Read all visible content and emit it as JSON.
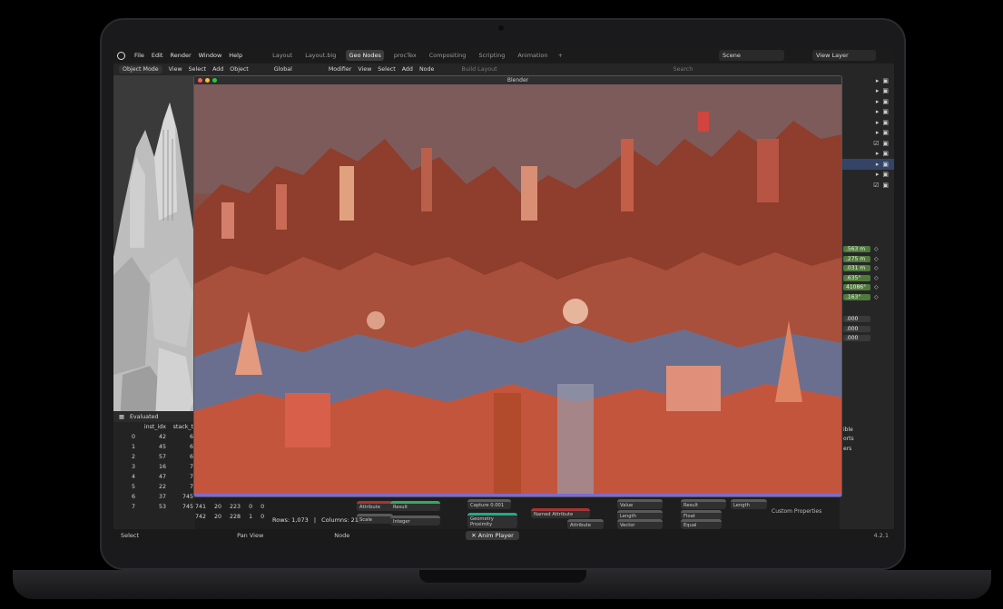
{
  "menus": [
    "File",
    "Edit",
    "Render",
    "Window",
    "Help"
  ],
  "workspace_tabs": [
    {
      "label": "Layout",
      "active": false
    },
    {
      "label": "Layout.big",
      "active": false
    },
    {
      "label": "Geo Nodes",
      "active": true
    },
    {
      "label": "procTex",
      "active": false
    },
    {
      "label": "Compositing",
      "active": false
    },
    {
      "label": "Scripting",
      "active": false
    },
    {
      "label": "Animation",
      "active": false
    }
  ],
  "plus_tab": "+",
  "scene": "Scene",
  "view_layer": "View Layer",
  "toolbar": {
    "mode": "Object Mode",
    "view": "View",
    "select": "Select",
    "add": "Add",
    "object": "Object",
    "orientation": "Global",
    "modifier": "Modifier",
    "view2": "View",
    "select2": "Select",
    "add2": "Add",
    "node": "Node",
    "build_layout": "Build Layout",
    "search_placeholder": "Search"
  },
  "player": {
    "title": "Blender"
  },
  "spreadsheet": {
    "mode": "Evaluated",
    "columns": [
      "",
      "inst_idx",
      "stack_t"
    ],
    "rows": [
      {
        "i": "0",
        "a": "42",
        "b": "6"
      },
      {
        "i": "1",
        "a": "45",
        "b": "6"
      },
      {
        "i": "2",
        "a": "57",
        "b": "6"
      },
      {
        "i": "3",
        "a": "16",
        "b": "7"
      },
      {
        "i": "4",
        "a": "47",
        "b": "7"
      },
      {
        "i": "5",
        "a": "22",
        "b": "7"
      },
      {
        "i": "6",
        "a": "37",
        "b": "745"
      },
      {
        "i": "7",
        "a": "53",
        "b": "745"
      }
    ],
    "extra_row6": [
      "741",
      "20",
      "223",
      "0",
      "0"
    ],
    "extra_row7": [
      "742",
      "20",
      "228",
      "1",
      "0"
    ],
    "rows_label": "Rows: 1,073",
    "columns_label": "Columns: 21"
  },
  "properties": {
    "values": [
      ".563 m",
      ".275 m",
      ".031 m",
      ".635°",
      "41086°",
      ".163°"
    ],
    "gray_values": [
      ".000",
      ".000",
      ".000"
    ],
    "custom_properties": "Custom Properties",
    "labels": [
      "ible",
      "orts",
      "ers"
    ]
  },
  "nodes": {
    "n1": "Capture",
    "n2": "Geometry Proximity",
    "n3": "Named Attribute",
    "n4": "Attribute",
    "n5": "Result",
    "n6": "Length",
    "n7": "Vector",
    "n8": "Float",
    "n9": "Equal",
    "n10": "Integer",
    "n11": "Attribute",
    "n12": "Scale",
    "n13": "Value",
    "n14": "Result",
    "n15": "Length",
    "n16": "0.001"
  },
  "statusbar": {
    "select": "Select",
    "pan": "Pan View",
    "node": "Node",
    "anim": "Anim Player"
  },
  "version": "4.2.1"
}
